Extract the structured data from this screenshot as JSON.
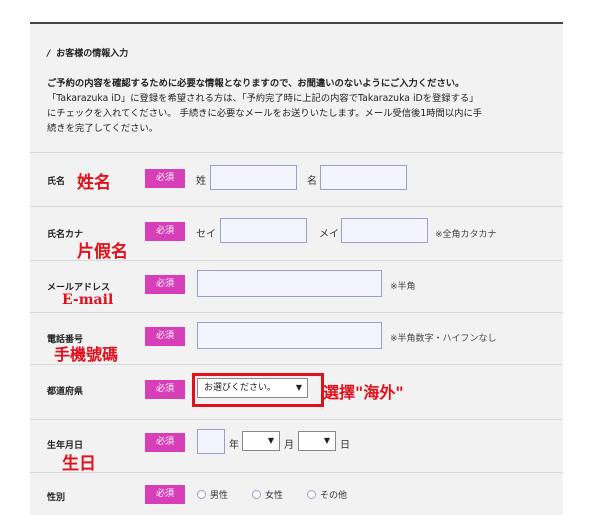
{
  "section": {
    "marker": "/",
    "title": "お客様の情報入力",
    "intro_bold": "ご予約の内容を確認するために必要な情報となりますので、お間違いのないようにご入力ください。",
    "intro_lines": [
      "「Takarazuka iD」に登録を希望される方は、「予約完了時に上記の内容でTakarazuka iDを登録する」",
      "にチェックを入れてください。 手続きに必要なメールをお送りいたします。メール受信後1時間以内に手",
      "続きを完了してください。"
    ]
  },
  "required_label": "必須",
  "fields": {
    "name": {
      "label": "氏名",
      "last_label": "姓",
      "first_label": "名",
      "last_value": "",
      "first_value": "",
      "annotation": "姓名"
    },
    "kana": {
      "label": "氏名カナ",
      "last_label": "セイ",
      "first_label": "メイ",
      "last_value": "",
      "first_value": "",
      "note": "※全角カタカナ",
      "annotation": "片假名"
    },
    "email": {
      "label": "メールアドレス",
      "value": "",
      "note": "※半角",
      "annotation": "E-mail"
    },
    "phone": {
      "label": "電話番号",
      "value": "",
      "note": "※半角数字・ハイフンなし",
      "annotation": "手機號碼"
    },
    "prefecture": {
      "label": "都道府県",
      "selected": "お選びください。",
      "arrow": "▼",
      "annotation": "選擇\"海外\""
    },
    "birthday": {
      "label": "生年月日",
      "year_value": "",
      "year_label": "年",
      "month_label": "月",
      "day_label": "日",
      "month_value": "",
      "day_value": "",
      "arrow": "▼",
      "annotation": "生日"
    },
    "gender": {
      "label": "性別",
      "options": [
        "男性",
        "女性",
        "その他"
      ]
    }
  },
  "colors": {
    "required_badge": "#d63fb8",
    "annotation": "#e0101c",
    "input_bg": "#f4f4ff"
  }
}
